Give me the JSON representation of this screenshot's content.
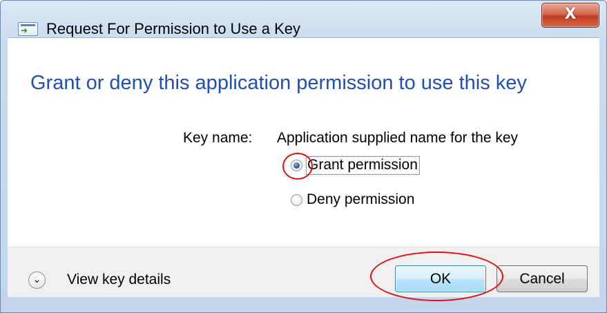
{
  "window": {
    "title": "Request For Permission to Use a Key",
    "close_label": "X",
    "title_icon": "run-icon"
  },
  "content": {
    "headline": "Grant or deny this application permission to use this key",
    "key_name_label": "Key name:",
    "key_name_value": "Application supplied name for the key",
    "options": [
      {
        "label": "Grant permission",
        "selected": true
      },
      {
        "label": "Deny permission",
        "selected": false
      }
    ]
  },
  "footer": {
    "details_icon": "chevron-down-icon",
    "details_label": "View key details",
    "ok_label": "OK",
    "cancel_label": "Cancel"
  },
  "colors": {
    "headline": "#1f4fb5",
    "annotation": "#e01010",
    "close_button": "#c23b1f"
  }
}
